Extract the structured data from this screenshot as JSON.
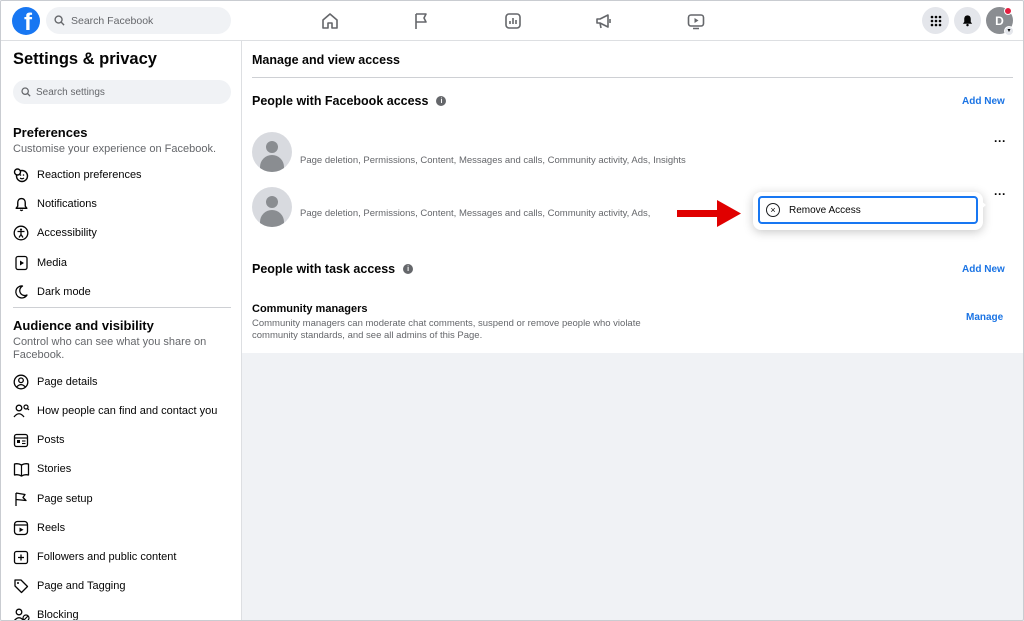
{
  "topbar": {
    "logo_letter": "f",
    "search_placeholder": "Search Facebook",
    "avatar_letter": "D"
  },
  "sidebar": {
    "title": "Settings & privacy",
    "search_placeholder": "Search settings",
    "preferences": {
      "heading": "Preferences",
      "subtitle": "Customise your experience on Facebook.",
      "items": [
        {
          "label": "Reaction preferences",
          "icon": "reaction-icon"
        },
        {
          "label": "Notifications",
          "icon": "bell-icon"
        },
        {
          "label": "Accessibility",
          "icon": "accessibility-icon"
        },
        {
          "label": "Media",
          "icon": "media-icon"
        },
        {
          "label": "Dark mode",
          "icon": "moon-icon"
        }
      ]
    },
    "audience": {
      "heading": "Audience and visibility",
      "subtitle": "Control who can see what you share on Facebook.",
      "items": [
        {
          "label": "Page details",
          "icon": "user-circle-icon"
        },
        {
          "label": "How people can find and contact you",
          "icon": "user-search-icon"
        },
        {
          "label": "Posts",
          "icon": "posts-icon"
        },
        {
          "label": "Stories",
          "icon": "book-icon"
        },
        {
          "label": "Page setup",
          "icon": "flag-icon"
        },
        {
          "label": "Reels",
          "icon": "reels-icon"
        },
        {
          "label": "Followers and public content",
          "icon": "followers-icon"
        },
        {
          "label": "Page and Tagging",
          "icon": "tag-icon"
        },
        {
          "label": "Blocking",
          "icon": "blocking-icon"
        }
      ]
    }
  },
  "main": {
    "title": "Manage and view access",
    "facebook_access": {
      "heading": "People with Facebook access",
      "add_new": "Add New",
      "people": [
        {
          "permissions": "Page deletion, Permissions, Content, Messages and calls, Community activity, Ads, Insights"
        },
        {
          "permissions": "Page deletion, Permissions, Content, Messages and calls, Community activity, Ads,"
        }
      ],
      "more_label": "···"
    },
    "popover": {
      "remove_label": "Remove Access"
    },
    "task_access": {
      "heading": "People with task access",
      "add_new": "Add New",
      "community_title": "Community managers",
      "community_desc": "Community managers can moderate chat comments, suspend or remove people who violate community standards, and see all admins of this Page.",
      "manage_label": "Manage"
    }
  },
  "colors": {
    "brand": "#1877f2",
    "link": "#1b74e4",
    "annotation_arrow": "#e00000",
    "notification_dot": "#e41e3f"
  }
}
